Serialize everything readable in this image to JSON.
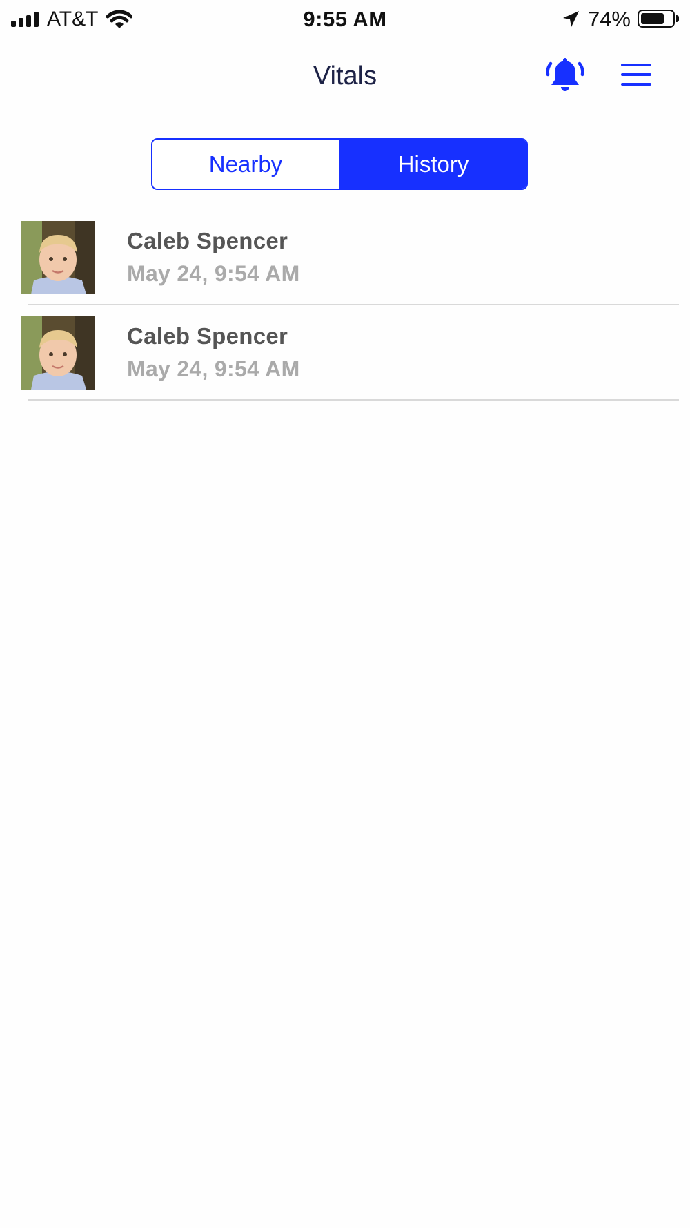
{
  "status_bar": {
    "carrier": "AT&T",
    "time": "9:55 AM",
    "battery_percent": "74%",
    "battery_level": 0.74,
    "icons": [
      "signal-icon",
      "wifi-icon",
      "location-arrow-icon",
      "battery-icon"
    ]
  },
  "header": {
    "title": "Vitals",
    "icons": [
      "bell-icon",
      "menu-icon"
    ]
  },
  "segmented": {
    "tabs": [
      {
        "label": "Nearby",
        "selected": false
      },
      {
        "label": "History",
        "selected": true
      }
    ]
  },
  "history": [
    {
      "name": "Caleb Spencer",
      "time": "May 24, 9:54 AM"
    },
    {
      "name": "Caleb Spencer",
      "time": "May 24, 9:54 AM"
    }
  ],
  "colors": {
    "accent": "#1730ff",
    "title": "#1d2246",
    "name_text": "#555555",
    "time_text": "#aaaaaa",
    "divider": "#d9d9d9"
  }
}
